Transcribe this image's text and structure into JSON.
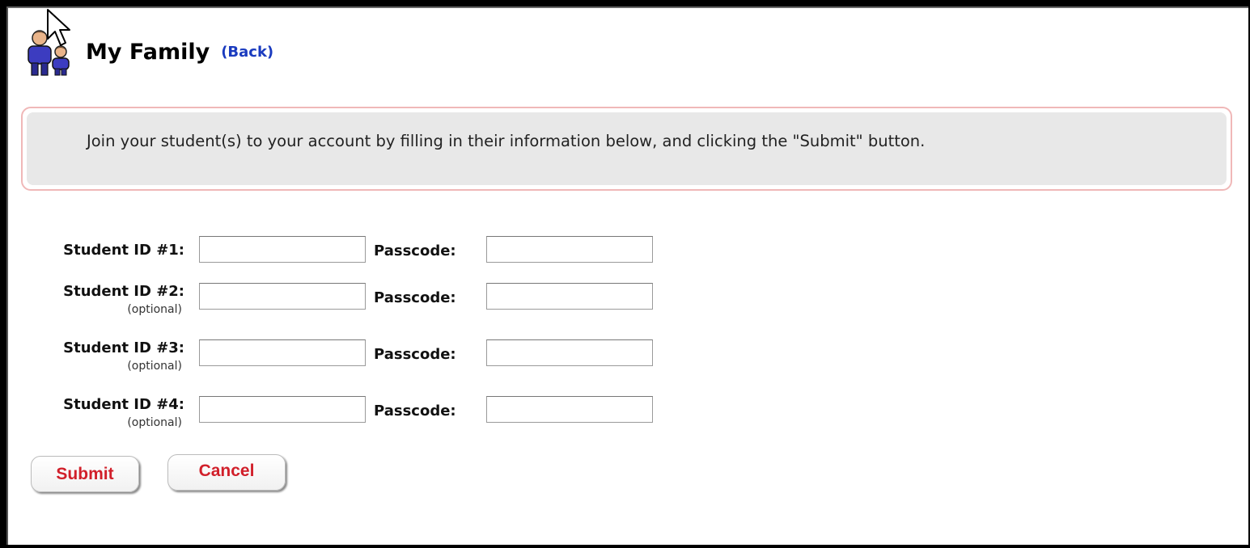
{
  "header": {
    "title": "My Family",
    "back_link": "(Back)"
  },
  "info": {
    "text": "Join your student(s) to your account by filling in their information below, and clicking the \"Submit\" button."
  },
  "form": {
    "rows": [
      {
        "label": "Student ID #1:",
        "optional": "",
        "passcode_label": "Passcode:",
        "student_id_value": "",
        "passcode_value": ""
      },
      {
        "label": "Student ID #2:",
        "optional": "(optional)",
        "passcode_label": "Passcode:",
        "student_id_value": "",
        "passcode_value": ""
      },
      {
        "label": "Student ID #3:",
        "optional": "(optional)",
        "passcode_label": "Passcode:",
        "student_id_value": "",
        "passcode_value": ""
      },
      {
        "label": "Student ID #4:",
        "optional": "(optional)",
        "passcode_label": "Passcode:",
        "student_id_value": "",
        "passcode_value": ""
      }
    ]
  },
  "buttons": {
    "submit": "Submit",
    "cancel": "Cancel"
  },
  "colors": {
    "link": "#1a3bbf",
    "button_text": "#d11f2a",
    "info_border": "#f0b8b8",
    "info_bg": "#e8e8e8",
    "icon_body": "#3c3cc0"
  },
  "icons": {
    "family": "family-icon",
    "cursor": "mouse-pointer-icon"
  }
}
